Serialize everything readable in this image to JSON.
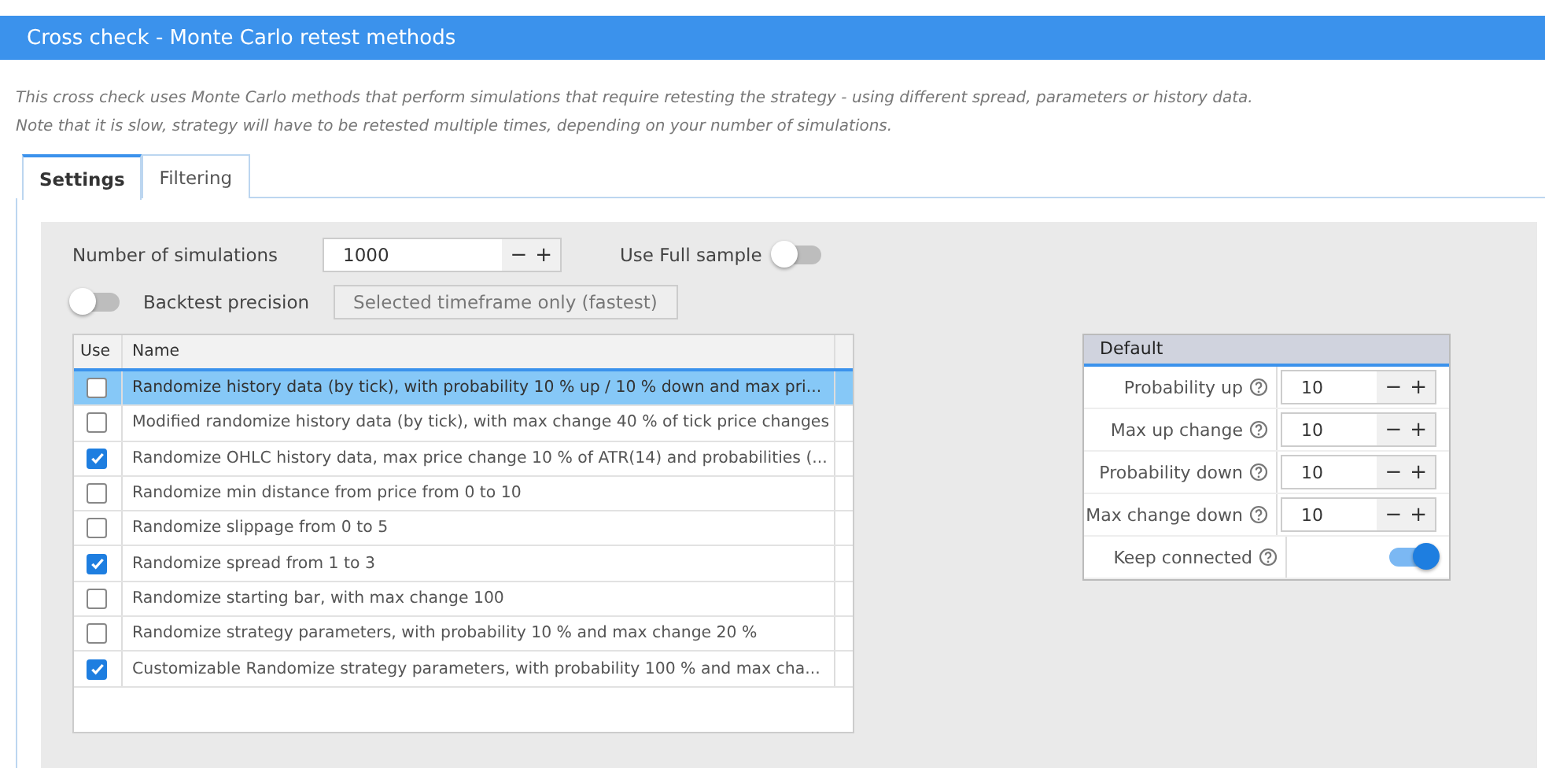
{
  "window": {
    "title": "Cross check - Monte Carlo retest methods"
  },
  "description": [
    "This cross check uses Monte Carlo methods that perform simulations that require retesting the strategy - using different spread, parameters or history data.",
    "Note that it is slow, strategy will have to be retested multiple times, depending on your number of simulations."
  ],
  "tabs": [
    {
      "label": "Settings",
      "selected": true
    },
    {
      "label": "Filtering",
      "selected": false
    }
  ],
  "simulations": {
    "label": "Number of simulations",
    "value": "1000",
    "minus": "−",
    "plus": "+"
  },
  "full_sample": {
    "label": "Use Full sample",
    "on": false
  },
  "backtest_precision": {
    "label": "Backtest precision",
    "on": false,
    "value": "Selected timeframe only (fastest)"
  },
  "table": {
    "columns": [
      "Use",
      "Name"
    ],
    "rows": [
      {
        "checked": false,
        "selected": true,
        "name": "Randomize history data (by tick), with probability 10 % up / 10 % down and max pri..."
      },
      {
        "checked": false,
        "selected": false,
        "name": "Modified randomize history data (by tick), with max change 40 % of tick price changes"
      },
      {
        "checked": true,
        "selected": false,
        "name": "Randomize OHLC history data, max price change 10 % of ATR(14) and probabilities (..."
      },
      {
        "checked": false,
        "selected": false,
        "name": "Randomize min distance from price from 0 to 10"
      },
      {
        "checked": false,
        "selected": false,
        "name": "Randomize slippage from 0 to 5"
      },
      {
        "checked": true,
        "selected": false,
        "name": "Randomize spread from 1 to 3"
      },
      {
        "checked": false,
        "selected": false,
        "name": "Randomize starting bar, with max change 100"
      },
      {
        "checked": false,
        "selected": false,
        "name": "Randomize strategy parameters, with probability 10 % and max change 20 %"
      },
      {
        "checked": true,
        "selected": false,
        "name": "Customizable Randomize strategy parameters, with probability 100 % and max cha..."
      }
    ]
  },
  "properties": {
    "title": "Default",
    "rows": [
      {
        "kind": "number",
        "label": "Probability up",
        "value": "10",
        "minus": "−",
        "plus": "+"
      },
      {
        "kind": "number",
        "label": "Max up change",
        "value": "10",
        "minus": "−",
        "plus": "+"
      },
      {
        "kind": "number",
        "label": "Probability down",
        "value": "10",
        "minus": "−",
        "plus": "+"
      },
      {
        "kind": "number",
        "label": "Max change down",
        "value": "10",
        "minus": "−",
        "plus": "+"
      },
      {
        "kind": "toggle",
        "label": "Keep connected",
        "on": true
      }
    ]
  }
}
